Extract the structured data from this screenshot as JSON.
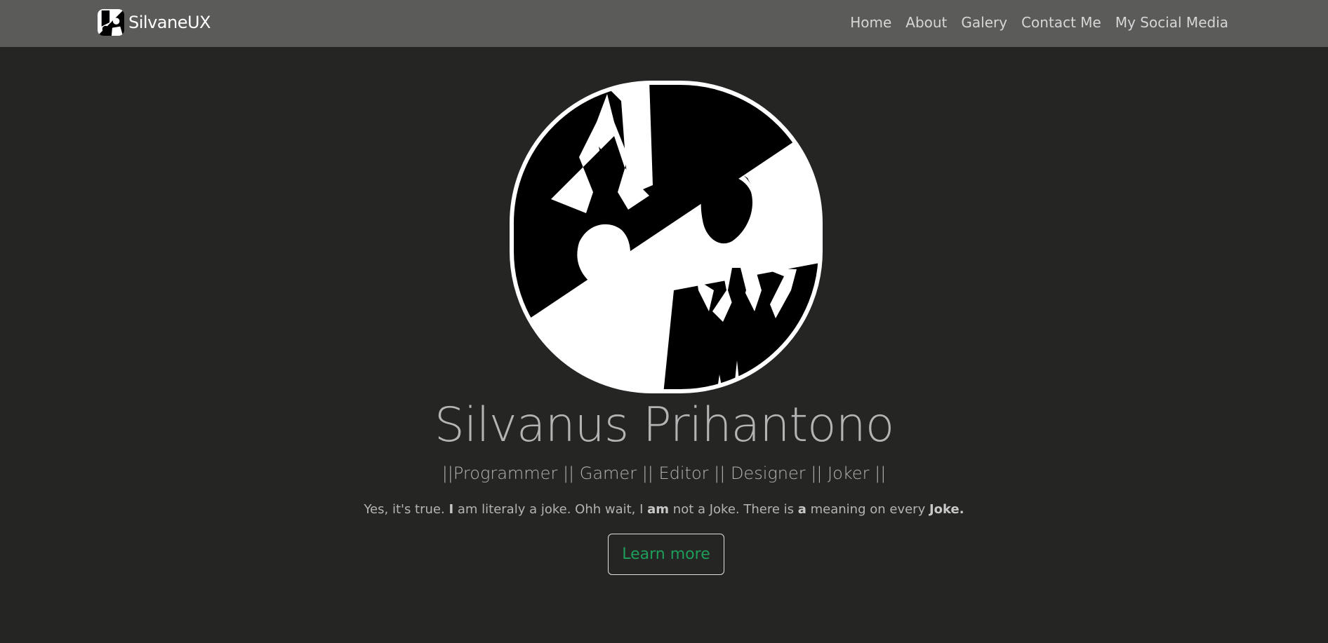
{
  "navbar": {
    "brand": "SilvaneUX",
    "links": [
      "Home",
      "About",
      "Galery",
      "Contact Me",
      "My Social Media"
    ]
  },
  "hero": {
    "name": "Silvanus Prihantono",
    "roles": "||Programmer || Gamer || Editor || Designer || Joker ||",
    "description": [
      {
        "text": "Yes, it's true. ",
        "bold": false
      },
      {
        "text": "I",
        "bold": true
      },
      {
        "text": " am literaly a joke. Ohh wait, I ",
        "bold": false
      },
      {
        "text": "am",
        "bold": true
      },
      {
        "text": " not a Joke. There is ",
        "bold": false
      },
      {
        "text": "a",
        "bold": true
      },
      {
        "text": " meaning on every ",
        "bold": false
      },
      {
        "text": "Joke.",
        "bold": true
      }
    ],
    "button_label": "Learn more"
  },
  "colors": {
    "background": "#252523",
    "navbar": "#5b5b5a",
    "button_text": "#1e9e5b"
  }
}
